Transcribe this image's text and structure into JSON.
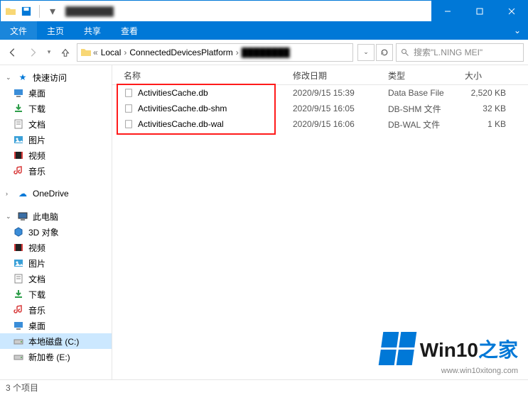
{
  "titlebar": {
    "title": "████████"
  },
  "ribbon": {
    "file": "文件",
    "tabs": [
      "主页",
      "共享",
      "查看"
    ]
  },
  "breadcrumbs": {
    "items": [
      "Local",
      "ConnectedDevicesPlatform",
      "████████"
    ]
  },
  "search": {
    "placeholder": "搜索\"L.NING MEI\""
  },
  "sidebar": {
    "quickaccess": {
      "label": "快速访问"
    },
    "qa_items": [
      {
        "label": "桌面",
        "icon": "desktop"
      },
      {
        "label": "下载",
        "icon": "download"
      },
      {
        "label": "文档",
        "icon": "doc"
      },
      {
        "label": "图片",
        "icon": "img"
      },
      {
        "label": "视频",
        "icon": "vid"
      },
      {
        "label": "音乐",
        "icon": "music"
      }
    ],
    "onedrive": {
      "label": "OneDrive"
    },
    "thispc": {
      "label": "此电脑"
    },
    "pc_items": [
      {
        "label": "3D 对象",
        "icon": "3d"
      },
      {
        "label": "视频",
        "icon": "vid"
      },
      {
        "label": "图片",
        "icon": "img"
      },
      {
        "label": "文档",
        "icon": "doc"
      },
      {
        "label": "下载",
        "icon": "download"
      },
      {
        "label": "音乐",
        "icon": "music"
      },
      {
        "label": "桌面",
        "icon": "desktop"
      },
      {
        "label": "本地磁盘 (C:)",
        "icon": "drive",
        "selected": true
      },
      {
        "label": "新加卷 (E:)",
        "icon": "drive"
      }
    ]
  },
  "columns": {
    "name": "名称",
    "date": "修改日期",
    "type": "类型",
    "size": "大小"
  },
  "files": [
    {
      "name": "ActivitiesCache.db",
      "date": "2020/9/15 15:39",
      "type": "Data Base File",
      "size": "2,520 KB"
    },
    {
      "name": "ActivitiesCache.db-shm",
      "date": "2020/9/15 16:05",
      "type": "DB-SHM 文件",
      "size": "32 KB"
    },
    {
      "name": "ActivitiesCache.db-wal",
      "date": "2020/9/15 16:06",
      "type": "DB-WAL 文件",
      "size": "1 KB"
    }
  ],
  "status": {
    "count": "3 个项目"
  },
  "watermark": {
    "brand_a": "Win10",
    "brand_b": "之家",
    "url": "www.win10xitong.com"
  }
}
